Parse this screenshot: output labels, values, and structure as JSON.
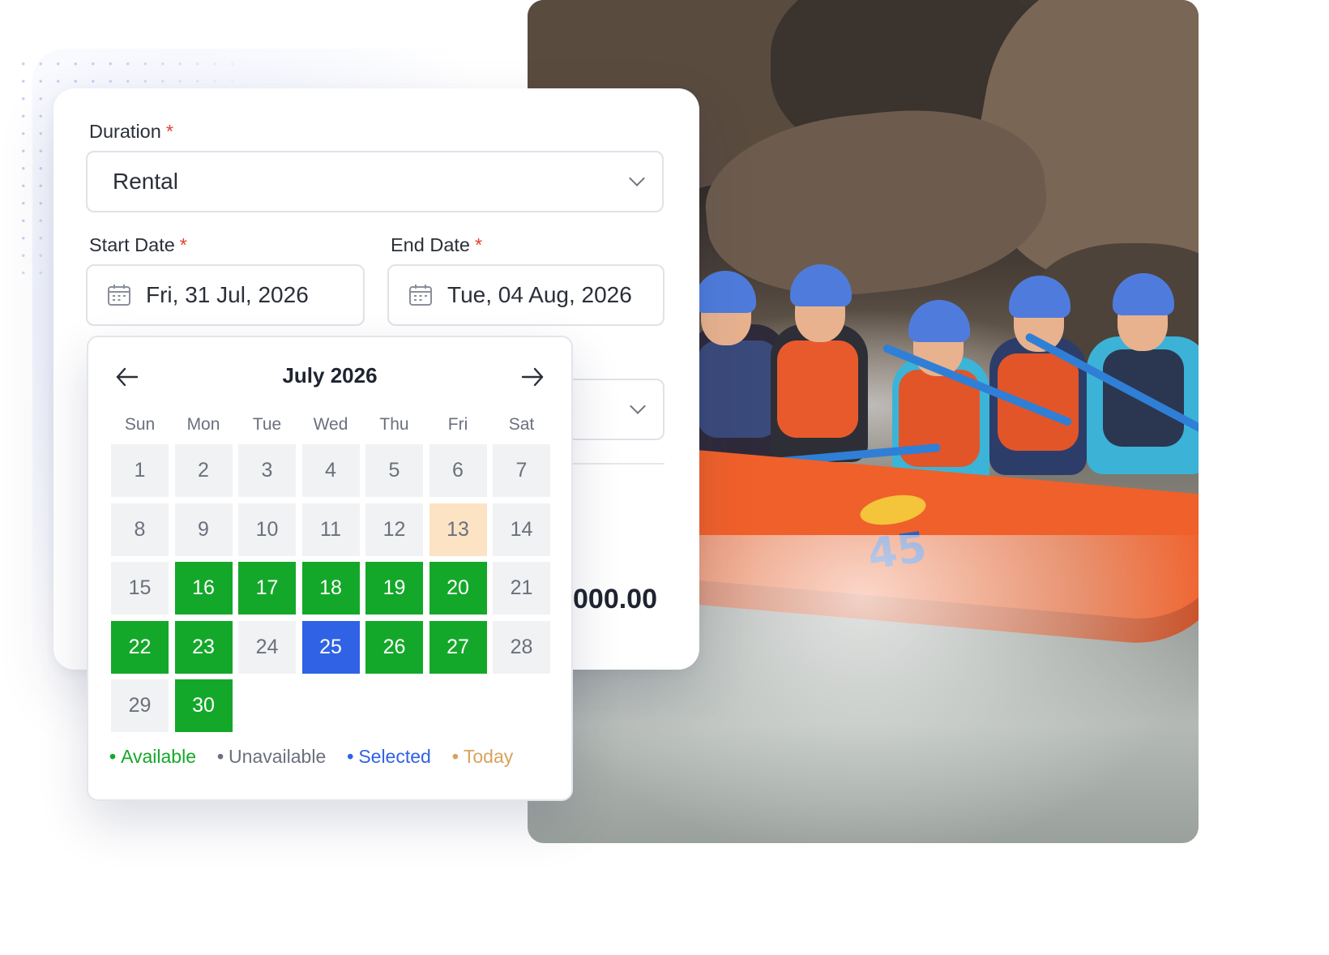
{
  "form": {
    "duration": {
      "label": "Duration",
      "required_mark": "*",
      "value": "Rental"
    },
    "start_date": {
      "label": "Start Date",
      "required_mark": "*",
      "value": "Fri, 31 Jul, 2026"
    },
    "end_date": {
      "label": "End Date",
      "required_mark": "*",
      "value": "Tue, 04 Aug, 2026"
    },
    "price_partial": "000.00"
  },
  "calendar": {
    "month_label": "July 2026",
    "weekdays": [
      "Sun",
      "Mon",
      "Tue",
      "Wed",
      "Thu",
      "Fri",
      "Sat"
    ],
    "first_weekday_index": 3,
    "days_in_month": 30,
    "available_days": [
      16,
      17,
      18,
      19,
      20,
      22,
      23,
      26,
      27,
      30
    ],
    "selected_day": 25,
    "today_day": 13,
    "legend": {
      "available": "Available",
      "unavailable": "Unavailable",
      "selected": "Selected",
      "today": "Today"
    },
    "colors": {
      "available": "#14a82a",
      "selected": "#2f62e5",
      "today": "#fbe3c4",
      "unavailable": "#f1f2f4"
    }
  },
  "icons": {
    "prev": "arrow-left-icon",
    "next": "arrow-right-icon",
    "calendar": "calendar-icon",
    "dropdown": "chevron-down-icon"
  }
}
